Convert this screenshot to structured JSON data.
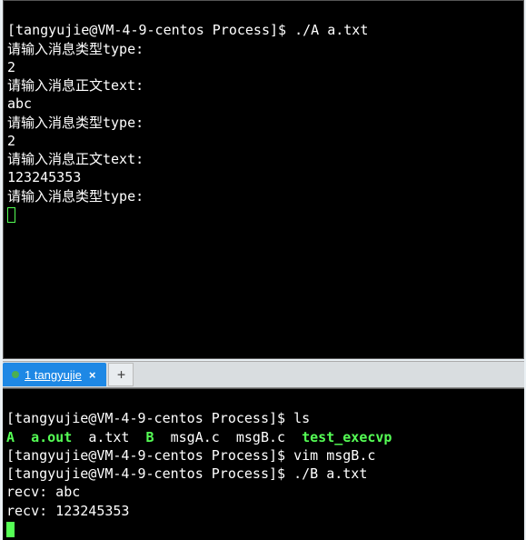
{
  "top": {
    "prompt": "[tangyujie@VM-4-9-centos Process]$ ",
    "cmd1": "./A a.txt",
    "lines": [
      "请输入消息类型type:",
      "2",
      "请输入消息正文text:",
      "abc",
      "请输入消息类型type:",
      "2",
      "请输入消息正文text:",
      "123245353",
      "请输入消息类型type:"
    ]
  },
  "tab": {
    "label": "1 tangyujie",
    "close": "×",
    "add": "+"
  },
  "bottom": {
    "prompt": "[tangyujie@VM-4-9-centos Process]$ ",
    "cmd_ls": "ls",
    "ls_A": "A",
    "ls_aout": "a.out",
    "ls_atxt": "a.txt",
    "ls_B": "B",
    "ls_msgA": "msgA.c",
    "ls_msgB": "msgB.c",
    "ls_test": "test_execvp",
    "cmd_vim": "vim msgB.c",
    "cmd_runB": "./B a.txt",
    "recv1": "recv: abc",
    "recv2": "recv: 123245353"
  }
}
